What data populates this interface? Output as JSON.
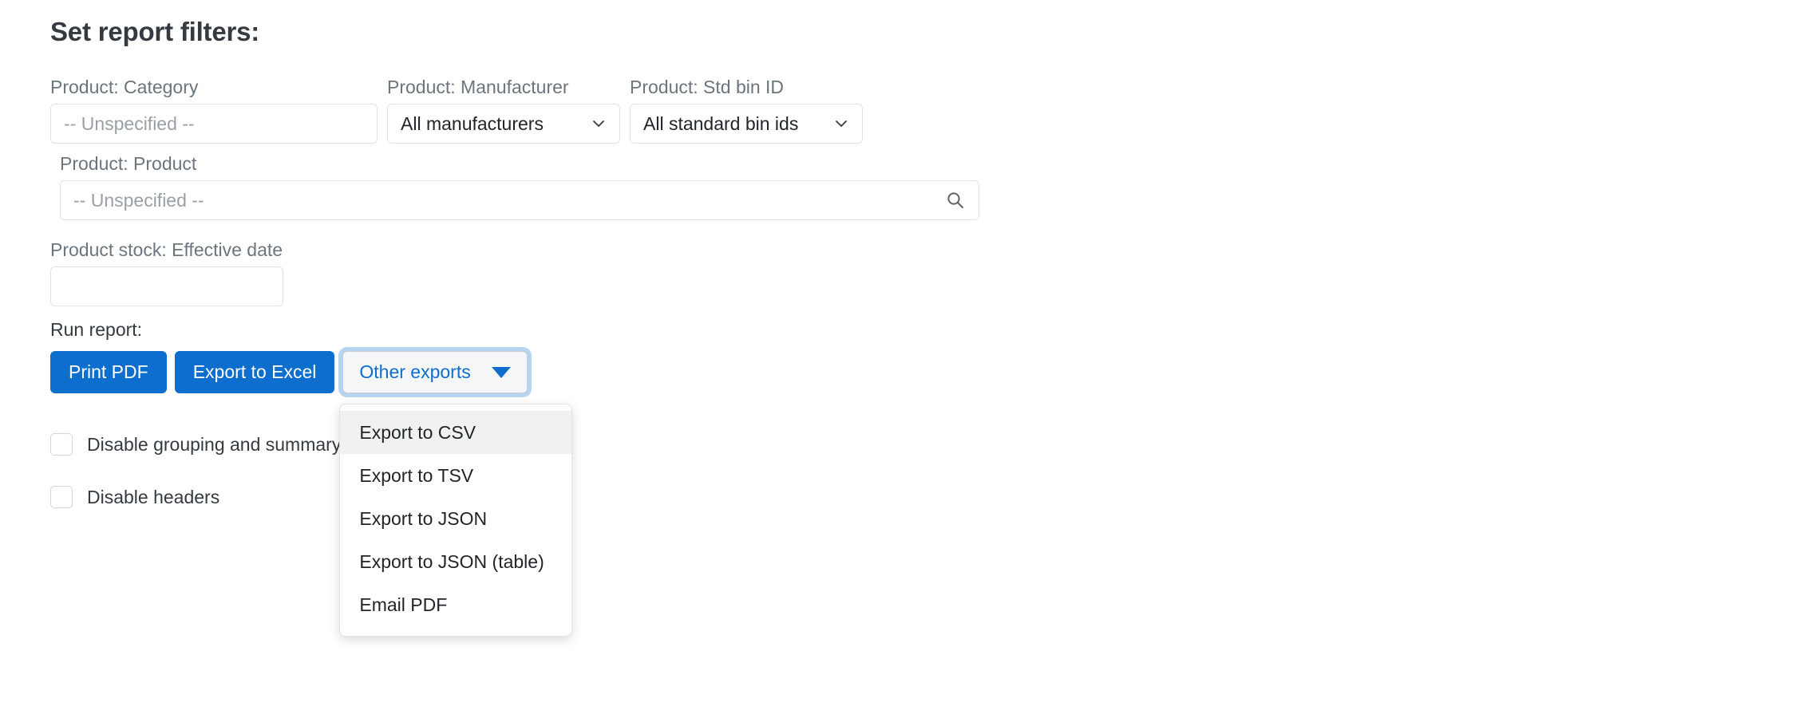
{
  "heading": "Set report filters:",
  "filters": {
    "category": {
      "label": "Product: Category",
      "value": "",
      "placeholder": "-- Unspecified --"
    },
    "manufacturer": {
      "label": "Product: Manufacturer",
      "value": "All manufacturers",
      "icon": "chevron-down-icon"
    },
    "std_bin_id": {
      "label": "Product: Std bin ID",
      "value": "All standard bin ids",
      "icon": "chevron-down-icon"
    },
    "product": {
      "label": "Product: Product",
      "value": "",
      "placeholder": "-- Unspecified --",
      "icon": "search-icon"
    },
    "effective_date": {
      "label": "Product stock: Effective date",
      "value": "",
      "placeholder": ""
    }
  },
  "run_report": {
    "label": "Run report:",
    "print_pdf": "Print PDF",
    "export_excel": "Export to Excel",
    "other_exports": "Other exports",
    "caret_icon": "chevron-down-icon"
  },
  "dropdown": {
    "items": [
      {
        "label": "Export to CSV",
        "active": true
      },
      {
        "label": "Export to TSV",
        "active": false
      },
      {
        "label": "Export to JSON",
        "active": false
      },
      {
        "label": "Export to JSON (table)",
        "active": false
      },
      {
        "label": "Email PDF",
        "active": false
      }
    ]
  },
  "options": [
    {
      "label": "Disable grouping and summary rows",
      "checked": false
    },
    {
      "label": "Disable headers",
      "checked": false
    }
  ],
  "colors": {
    "primary": "#0d6ecd",
    "label_gray": "#6c757d",
    "text": "#212529",
    "menu_hover": "#f1f1f1",
    "button_secondary_bg": "#f4f6f8"
  }
}
